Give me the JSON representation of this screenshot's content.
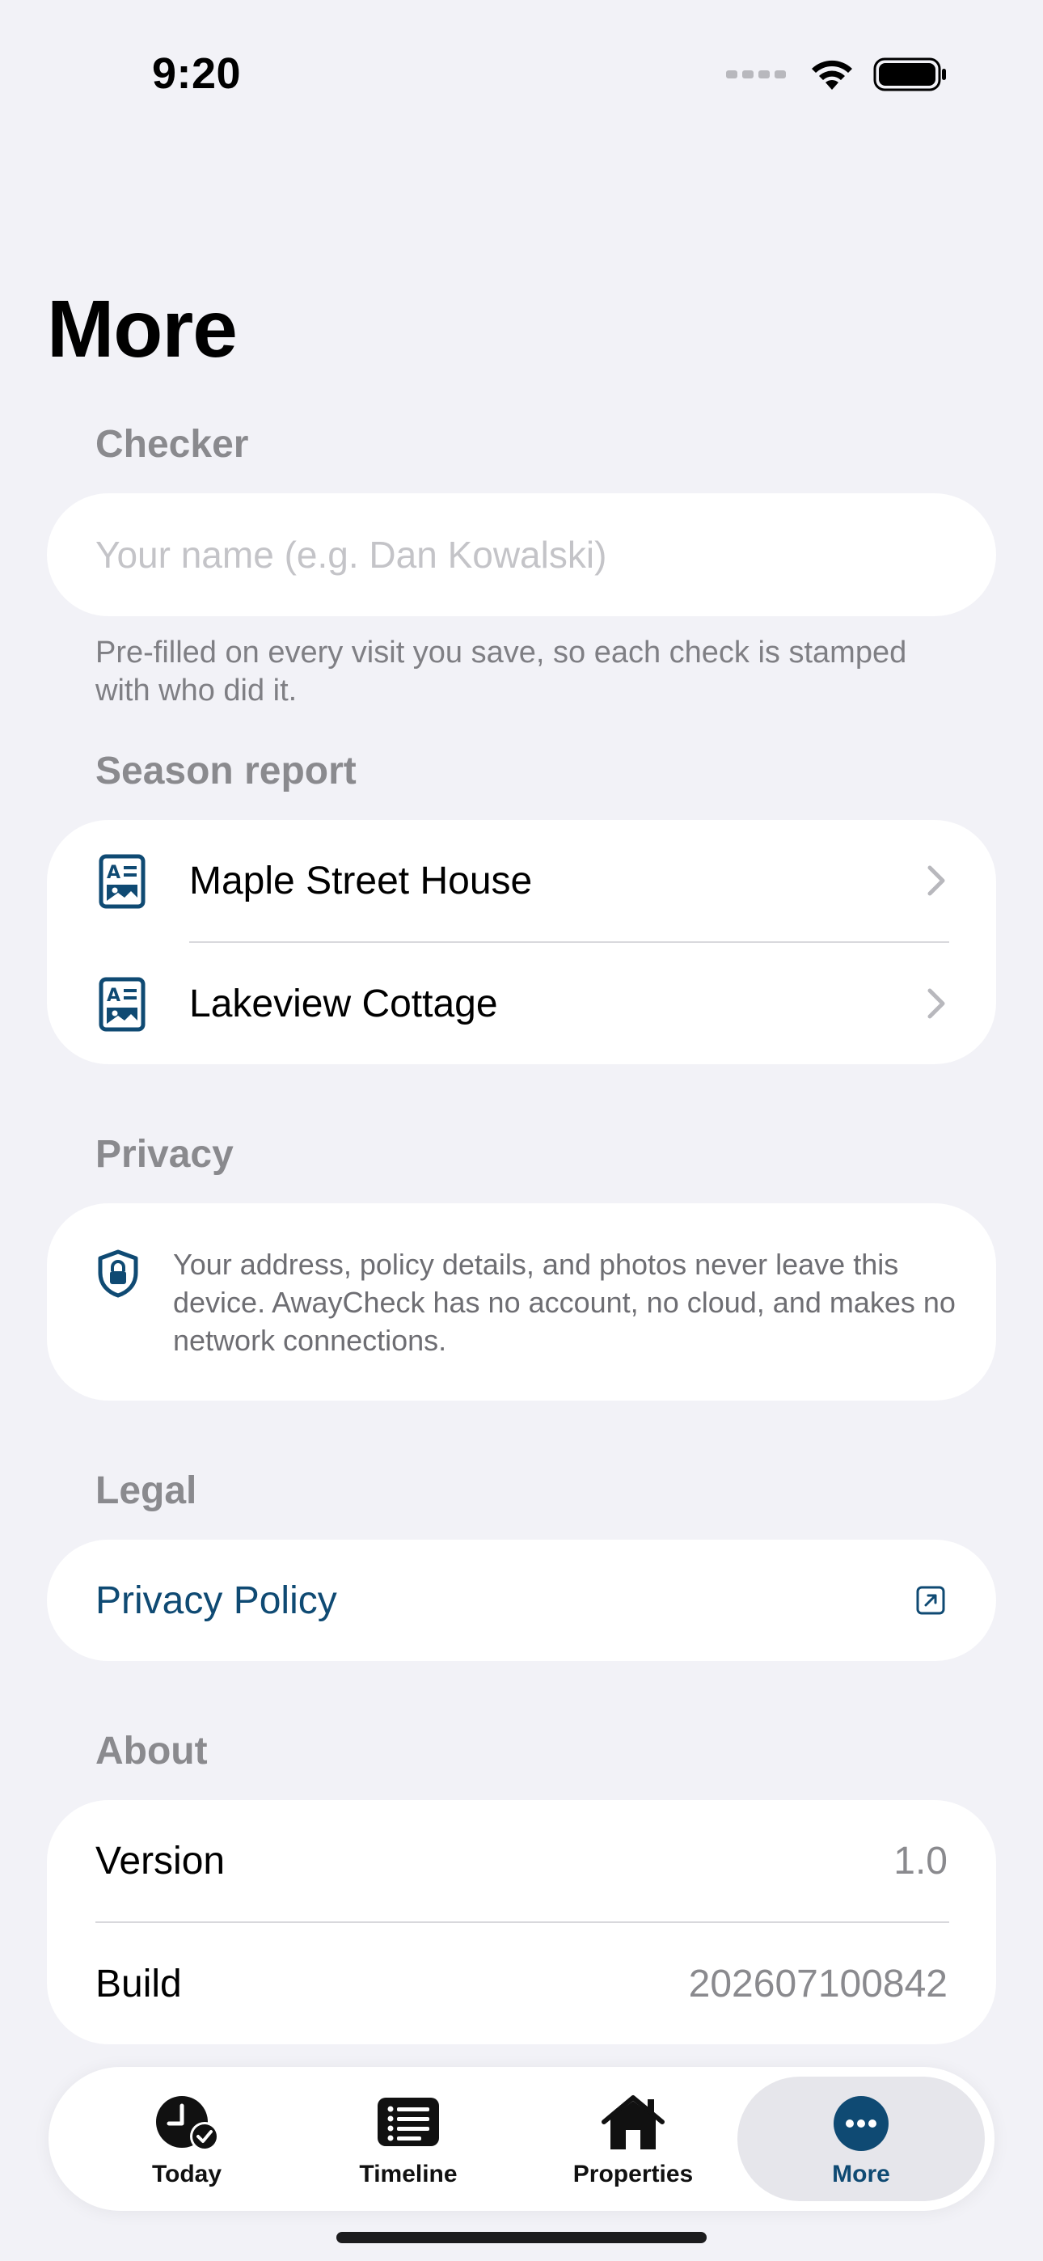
{
  "status_bar": {
    "time": "9:20"
  },
  "page_title": "More",
  "checker": {
    "header": "Checker",
    "name_placeholder": "Your name (e.g. Dan Kowalski)",
    "name_value": "",
    "footnote": "Pre-filled on every visit you save, so each check is stamped with who did it."
  },
  "season_report": {
    "header": "Season report",
    "items": [
      {
        "label": "Maple Street House",
        "icon": "report-card-icon"
      },
      {
        "label": "Lakeview Cottage",
        "icon": "report-card-icon"
      }
    ]
  },
  "privacy": {
    "header": "Privacy",
    "text": "Your address, policy details, and photos never leave this device. AwayCheck has no account, no cloud, and makes no network connections."
  },
  "legal": {
    "header": "Legal",
    "privacy_policy_label": "Privacy Policy"
  },
  "about": {
    "header": "About",
    "version_label": "Version",
    "version_value": "1.0",
    "build_label": "Build",
    "build_value": "202607100842"
  },
  "tabs": [
    {
      "label": "Today",
      "icon": "clock-check-icon",
      "active": false
    },
    {
      "label": "Timeline",
      "icon": "list-icon",
      "active": false
    },
    {
      "label": "Properties",
      "icon": "house-icon",
      "active": false
    },
    {
      "label": "More",
      "icon": "ellipsis-circle-icon",
      "active": true
    }
  ],
  "colors": {
    "accent": "#0f4a73",
    "background": "#f2f2f7",
    "secondary_text": "#8a8a8e"
  }
}
